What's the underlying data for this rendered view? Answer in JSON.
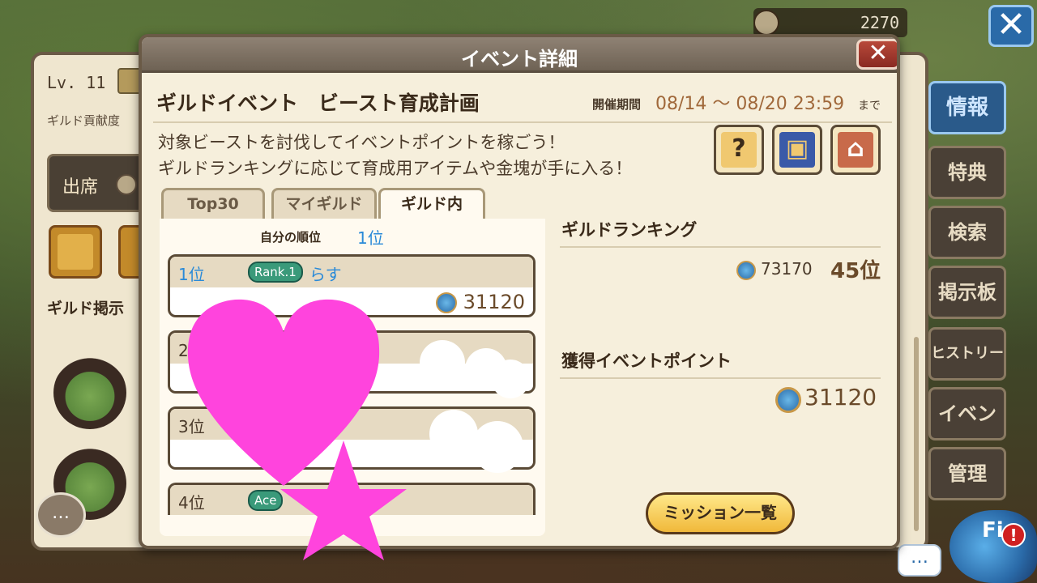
{
  "top_bar": {
    "currency_value": "2270"
  },
  "left_panel": {
    "level": "Lv. 11",
    "guild_contribution_label": "ギルド貢献度",
    "attendance_button": "出席",
    "guild_board_label": "ギルド掲示"
  },
  "side_tabs": [
    {
      "label": "情報",
      "active": true
    },
    {
      "label": "特典"
    },
    {
      "label": "検索"
    },
    {
      "label": "掲示板"
    },
    {
      "label": "ヒストリー"
    },
    {
      "label": "イベント"
    },
    {
      "label": "管理"
    }
  ],
  "field_button": {
    "label": "Fi",
    "alert": "!"
  },
  "chat_glyph": "…",
  "modal": {
    "title": "イベント詳細",
    "close_glyph": "✕",
    "event_name": "ギルドイベント　ビースト育成計画",
    "period_label": "開催期間",
    "period_value": "08/14 ～ 08/20 23:59",
    "period_until": "まで",
    "description_line1": "対象ビーストを討伐してイベントポイントを稼ごう！",
    "description_line2": "ギルドランキングに応じて育成用アイテムや金塊が手に入る！",
    "icon_buttons": [
      {
        "name": "help-beast-icon",
        "glyph": "?"
      },
      {
        "name": "treasure-chest-icon",
        "glyph": "▣"
      },
      {
        "name": "shop-icon",
        "glyph": "⌂"
      }
    ],
    "tabs": [
      "Top30",
      "マイギルド",
      "ギルド内"
    ],
    "active_tab": "ギルド内",
    "my_rank_label": "自分の順位",
    "my_rank_value": "1位",
    "rows": [
      {
        "rank": "1位",
        "badge": "Rank.1",
        "name": "らす",
        "points": "31120"
      },
      {
        "rank": "2位",
        "badge": "",
        "name": "",
        "points": ""
      },
      {
        "rank": "3位",
        "badge": "",
        "name": "",
        "points": ""
      },
      {
        "rank": "4位",
        "badge": "Ace",
        "name": "",
        "points": ""
      }
    ],
    "guild_ranking_label": "ギルドランキング",
    "guild_ranking_points": "73170",
    "guild_ranking_rank": "45位",
    "event_points_label": "獲得イベントポイント",
    "event_points_value": "31120",
    "mission_button": "ミッション一覧"
  },
  "colors": {
    "accent_blue": "#2a8ad8",
    "stickers": "#ff44dd",
    "panel_bg": "#f6efdc"
  }
}
